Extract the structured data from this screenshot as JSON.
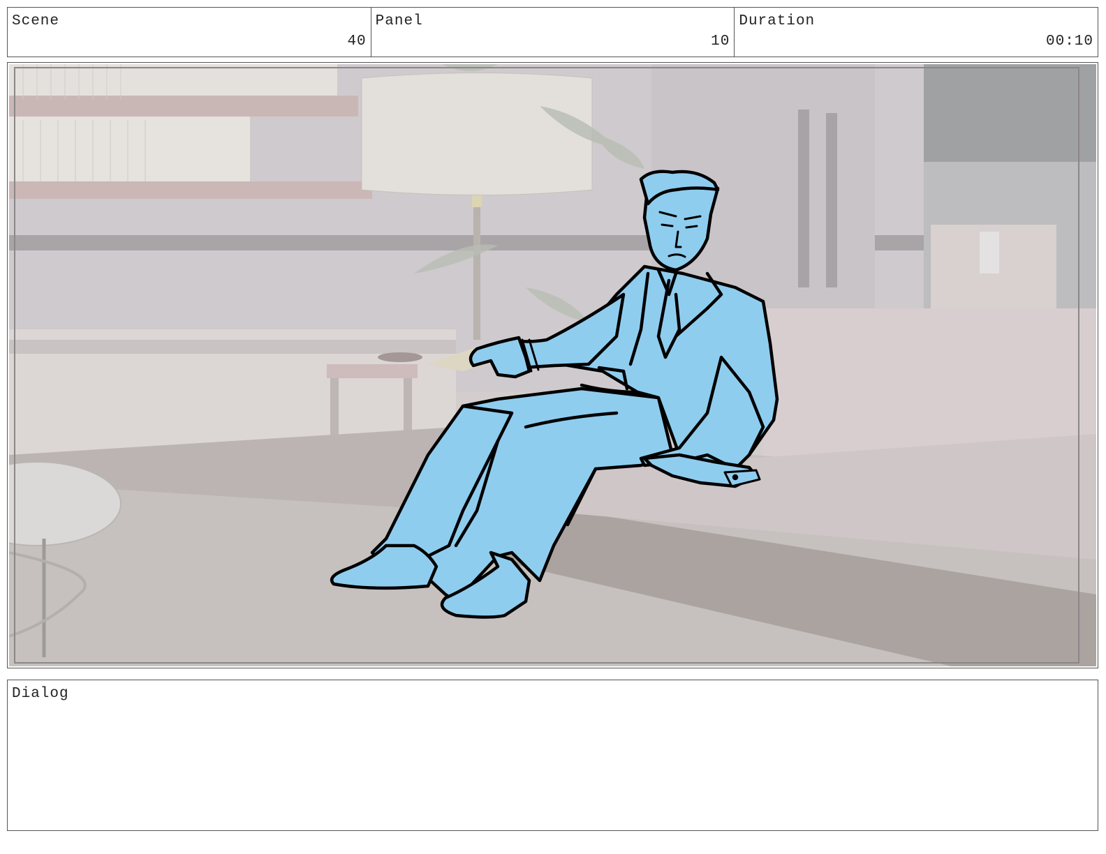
{
  "header": {
    "scene": {
      "label": "Scene",
      "value": "40"
    },
    "panel": {
      "label": "Panel",
      "value": "10"
    },
    "duration": {
      "label": "Duration",
      "value": "00:10"
    }
  },
  "panel_art": {
    "character_color": "#8fcdef",
    "outline_color": "#000000",
    "background_tint": "#d6d0d1"
  },
  "dialog": {
    "label": "Dialog",
    "text": ""
  }
}
